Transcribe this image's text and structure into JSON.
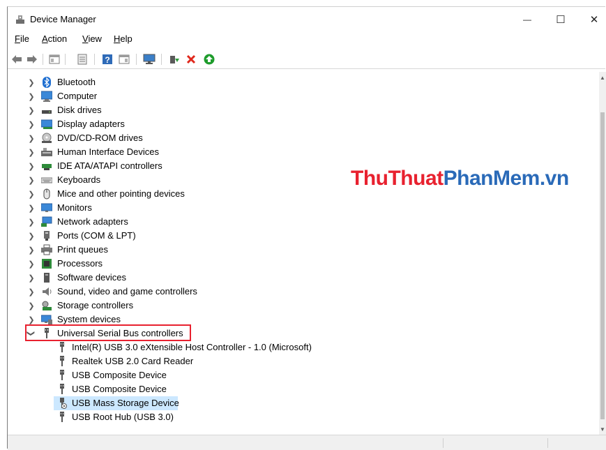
{
  "window": {
    "title": "Device Manager"
  },
  "window_controls": {
    "minimize": "—",
    "maximize": "☐",
    "close": "✕"
  },
  "menu": [
    {
      "key": "F",
      "rest": "ile"
    },
    {
      "key": "A",
      "rest": "ction"
    },
    {
      "key": "V",
      "rest": "iew"
    },
    {
      "key": "H",
      "rest": "elp"
    }
  ],
  "tree": [
    {
      "label": "Bluetooth",
      "icon": "bluetooth-icon",
      "expanded": false
    },
    {
      "label": "Computer",
      "icon": "computer-icon",
      "expanded": false
    },
    {
      "label": "Disk drives",
      "icon": "disk-drive-icon",
      "expanded": false
    },
    {
      "label": "Display adapters",
      "icon": "display-adapter-icon",
      "expanded": false
    },
    {
      "label": "DVD/CD-ROM drives",
      "icon": "dvd-drive-icon",
      "expanded": false
    },
    {
      "label": "Human Interface Devices",
      "icon": "hid-icon",
      "expanded": false
    },
    {
      "label": "IDE ATA/ATAPI controllers",
      "icon": "ide-controller-icon",
      "expanded": false
    },
    {
      "label": "Keyboards",
      "icon": "keyboard-icon",
      "expanded": false
    },
    {
      "label": "Mice and other pointing devices",
      "icon": "mouse-icon",
      "expanded": false
    },
    {
      "label": "Monitors",
      "icon": "monitor-icon",
      "expanded": false
    },
    {
      "label": "Network adapters",
      "icon": "network-adapter-icon",
      "expanded": false
    },
    {
      "label": "Ports (COM & LPT)",
      "icon": "port-icon",
      "expanded": false
    },
    {
      "label": "Print queues",
      "icon": "printer-icon",
      "expanded": false
    },
    {
      "label": "Processors",
      "icon": "processor-icon",
      "expanded": false
    },
    {
      "label": "Software devices",
      "icon": "software-device-icon",
      "expanded": false
    },
    {
      "label": "Sound, video and game controllers",
      "icon": "speaker-icon",
      "expanded": false
    },
    {
      "label": "Storage controllers",
      "icon": "storage-controller-icon",
      "expanded": false
    },
    {
      "label": "System devices",
      "icon": "system-device-icon",
      "expanded": false
    },
    {
      "label": "Universal Serial Bus controllers",
      "icon": "usb-icon",
      "expanded": true
    }
  ],
  "usb_children": [
    {
      "label": "Intel(R) USB 3.0 eXtensible Host Controller - 1.0 (Microsoft)",
      "selected": false
    },
    {
      "label": "Realtek USB 2.0 Card Reader",
      "selected": false
    },
    {
      "label": "USB Composite Device",
      "selected": false
    },
    {
      "label": "USB Composite Device",
      "selected": false
    },
    {
      "label": "USB Mass Storage Device",
      "selected": true
    },
    {
      "label": "USB Root Hub (USB 3.0)",
      "selected": false
    }
  ],
  "watermark": {
    "part1": "ThuThuat",
    "part2": "PhanMem",
    "part3": ".vn"
  },
  "colors": {
    "watermark_red": "#e8212f",
    "watermark_blue": "#2a6ab8",
    "selection": "#cce8ff",
    "highlight_border": "#e8212f"
  }
}
